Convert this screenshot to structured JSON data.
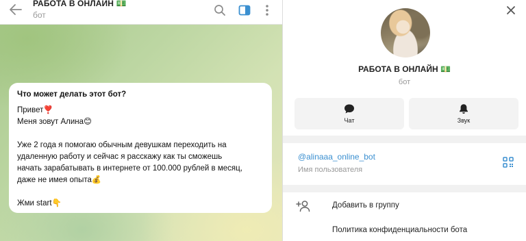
{
  "chat_header": {
    "title": "РАБОТА В ОНЛАЙН 💵",
    "subtitle": "бот"
  },
  "bubble": {
    "title": "Что может делать этот бот?",
    "lines": [
      "Привет❣️",
      "Меня зовут Алина😊",
      "",
      "Уже 2 года я помогаю обычным девушкам переходить на",
      "удаленную работу и сейчас я расскажу как ты сможешь",
      "начать зарабатывать в интернете от 100.000 рублей в месяц,",
      "даже не имея опыта💰",
      "",
      "Жми start👇"
    ]
  },
  "info": {
    "name": "РАБОТА В ОНЛАЙН 💵",
    "subtitle": "бот",
    "actions": {
      "chat": "Чат",
      "sound": "Звук"
    },
    "username": "@alinaaa_online_bot",
    "username_label": "Имя пользователя",
    "menu": {
      "add_to_group": "Добавить в группу",
      "privacy_policy": "Политика конфиденциальности бота"
    }
  },
  "colors": {
    "accent": "#3a8fd0",
    "link": "#3a8fd0",
    "muted": "#999999"
  },
  "icons": [
    "back-arrow",
    "search",
    "toggle-panel",
    "more-vertical",
    "close",
    "chat-bubble",
    "bell",
    "qr-code",
    "add-user"
  ]
}
